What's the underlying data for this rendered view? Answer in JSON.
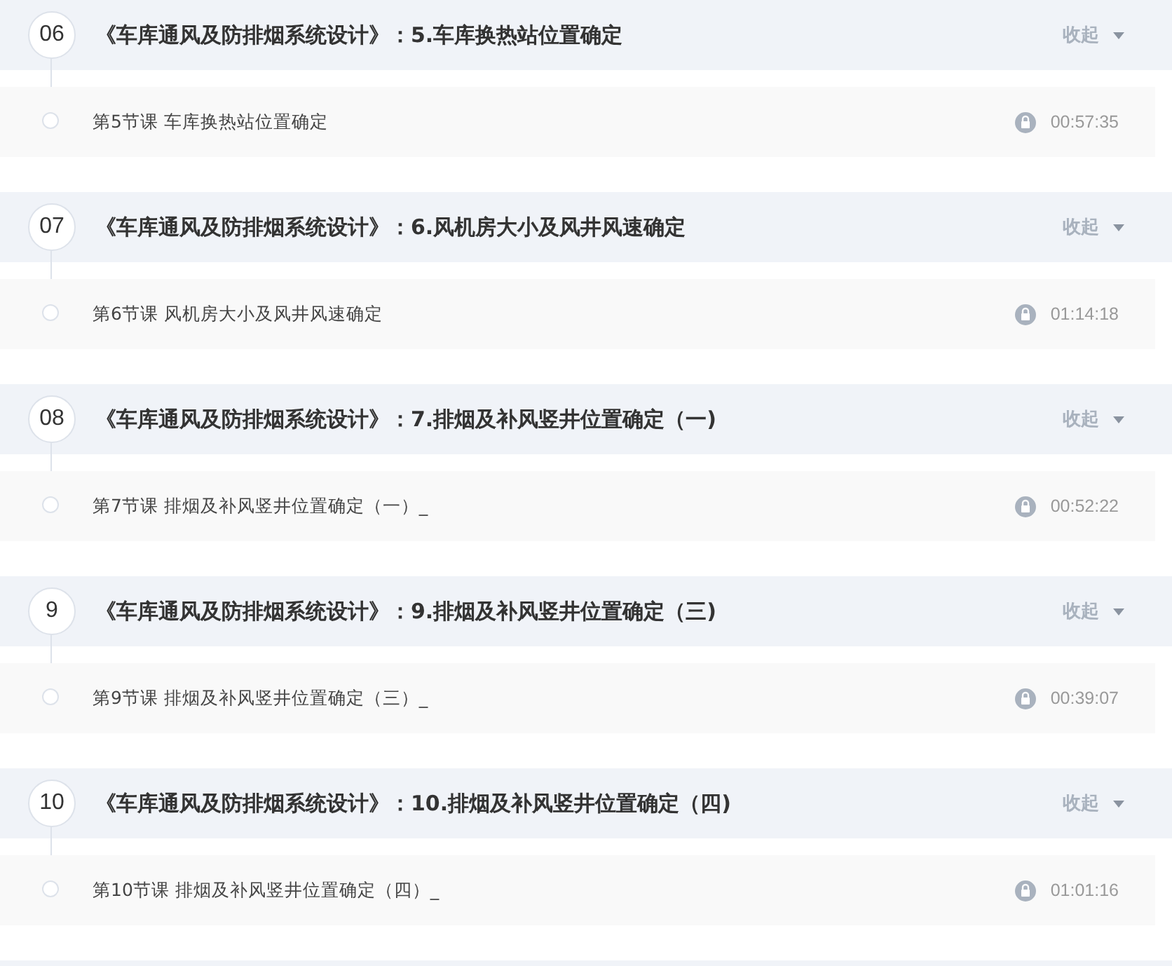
{
  "sections": [
    {
      "number": "06",
      "title": "《车库通风及防排烟系统设计》：5.车库换热站位置确定",
      "toggle": "收起",
      "expanded": true,
      "lessons": [
        {
          "title": "第5节课 车库换热站位置确定",
          "duration": "00:57:35",
          "locked": true
        }
      ]
    },
    {
      "number": "07",
      "title": "《车库通风及防排烟系统设计》：6.风机房大小及风井风速确定",
      "toggle": "收起",
      "expanded": true,
      "lessons": [
        {
          "title": "第6节课 风机房大小及风井风速确定",
          "duration": "01:14:18",
          "locked": true
        }
      ]
    },
    {
      "number": "08",
      "title": "《车库通风及防排烟系统设计》：7.排烟及补风竖井位置确定（一)",
      "toggle": "收起",
      "expanded": true,
      "lessons": [
        {
          "title": "第7节课 排烟及补风竖井位置确定（一）_",
          "duration": "00:52:22",
          "locked": true
        }
      ]
    },
    {
      "number": "9",
      "title": "《车库通风及防排烟系统设计》：9.排烟及补风竖井位置确定（三)",
      "toggle": "收起",
      "expanded": true,
      "lessons": [
        {
          "title": "第9节课 排烟及补风竖井位置确定（三）_",
          "duration": "00:39:07",
          "locked": true
        }
      ]
    },
    {
      "number": "10",
      "title": "《车库通风及防排烟系统设计》：10.排烟及补风竖井位置确定（四)",
      "toggle": "收起",
      "expanded": true,
      "lessons": [
        {
          "title": "第10节课 排烟及补风竖井位置确定（四）_",
          "duration": "01:01:16",
          "locked": true
        }
      ]
    }
  ]
}
